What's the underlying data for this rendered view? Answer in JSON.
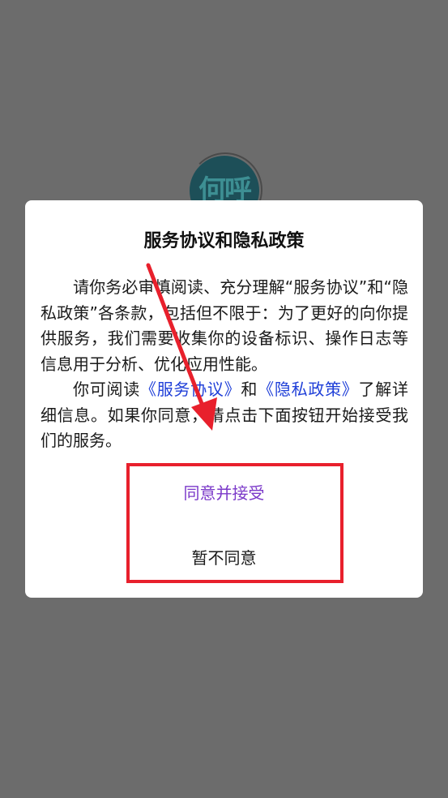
{
  "app": {
    "logo_text": "何呼"
  },
  "dialog": {
    "title": "服务协议和隐私政策",
    "paragraph1": "请你务必审慎阅读、充分理解“服务协议”和“隐私政策”各条款，包括但不限于：为了更好的向你提供服务，我们需要收集你的设备标识、操作日志等信息用于分析、优化应用性能。",
    "paragraph2_prefix": "你可阅读",
    "service_link": "《服务协议》",
    "paragraph2_and": "和",
    "privacy_link": "《隐私政策》",
    "paragraph2_suffix": "了解详细信息。如果你同意，请点击下面按钮开始接受我们的服务。",
    "agree_label": "同意并接受",
    "disagree_label": "暂不同意"
  },
  "colors": {
    "overlay": "#6c6c6c",
    "agree_text": "#7b39c9",
    "link_text": "#1f3fd8",
    "annotation_red": "#e8202c"
  }
}
